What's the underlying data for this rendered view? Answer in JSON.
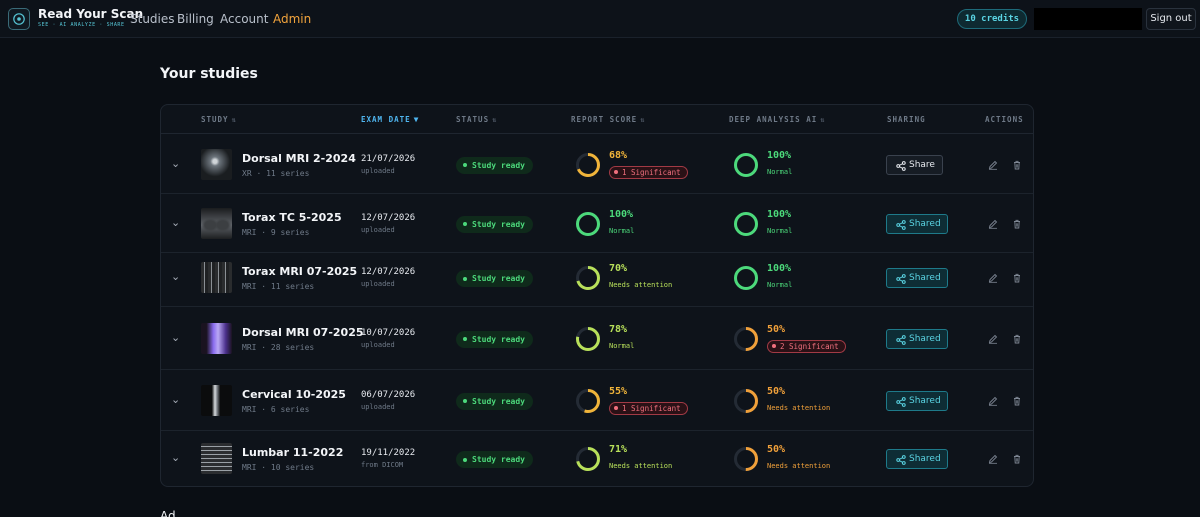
{
  "header": {
    "brand": "Read Your Scan",
    "tagline": "SEE · AI ANALYZE · SHARE",
    "nav": [
      "Studies",
      "Billing",
      "Account",
      "Admin"
    ],
    "credits": "10 credits",
    "signout_label": "Sign out"
  },
  "page": {
    "title": "Your studies"
  },
  "table": {
    "columns": [
      "STUDY",
      "EXAM DATE",
      "STATUS",
      "REPORT SCORE",
      "DEEP ANALYSIS AI",
      "SHARING",
      "ACTIONS"
    ],
    "rows": [
      {
        "name": "Dorsal MRI 2-2024",
        "sub": "XR · 11 series",
        "date": "21/07/2026",
        "date_sub": "uploaded",
        "status": "Study ready",
        "report": {
          "value": "68%",
          "pct": 68,
          "label": "1 Significant",
          "kind": "significant",
          "color": "#f0b43a"
        },
        "deep": {
          "value": "100%",
          "pct": 100,
          "label": "Normal",
          "kind": "text",
          "color": "#4cd97b"
        },
        "share": "Share",
        "shared": false
      },
      {
        "name": "Torax TC 5-2025",
        "sub": "MRI · 9 series",
        "date": "12/07/2026",
        "date_sub": "uploaded",
        "status": "Study ready",
        "report": {
          "value": "100%",
          "pct": 100,
          "label": "Normal",
          "kind": "text",
          "color": "#4cd97b"
        },
        "deep": {
          "value": "100%",
          "pct": 100,
          "label": "Normal",
          "kind": "text",
          "color": "#4cd97b"
        },
        "share": "Shared",
        "shared": true
      },
      {
        "name": "Torax MRI 07-2025",
        "sub": "MRI · 11 series",
        "date": "12/07/2026",
        "date_sub": "uploaded",
        "status": "Study ready",
        "report": {
          "value": "70%",
          "pct": 70,
          "label": "Needs attention",
          "kind": "text",
          "color": "#b8e05a"
        },
        "deep": {
          "value": "100%",
          "pct": 100,
          "label": "Normal",
          "kind": "text",
          "color": "#4cd97b"
        },
        "share": "Shared",
        "shared": true
      },
      {
        "name": "Dorsal MRI 07-2025",
        "sub": "MRI · 28 series",
        "date": "10/07/2026",
        "date_sub": "uploaded",
        "status": "Study ready",
        "report": {
          "value": "78%",
          "pct": 78,
          "label": "Normal",
          "kind": "text",
          "color": "#b8e05a"
        },
        "deep": {
          "value": "50%",
          "pct": 50,
          "label": "2 Significant",
          "kind": "significant",
          "color": "#f0a03a"
        },
        "share": "Shared",
        "shared": true
      },
      {
        "name": "Cervical 10-2025",
        "sub": "MRI · 6 series",
        "date": "06/07/2026",
        "date_sub": "uploaded",
        "status": "Study ready",
        "report": {
          "value": "55%",
          "pct": 55,
          "label": "1 Significant",
          "kind": "significant",
          "color": "#f0b43a"
        },
        "deep": {
          "value": "50%",
          "pct": 50,
          "label": "Needs attention",
          "kind": "text",
          "color": "#f0a03a"
        },
        "share": "Shared",
        "shared": true
      },
      {
        "name": "Lumbar 11-2022",
        "sub": "MRI · 10 series",
        "date": "19/11/2022",
        "date_sub": "from DICOM",
        "status": "Study ready",
        "report": {
          "value": "71%",
          "pct": 71,
          "label": "Needs attention",
          "kind": "text",
          "color": "#b8e05a"
        },
        "deep": {
          "value": "50%",
          "pct": 50,
          "label": "Needs attention",
          "kind": "text",
          "color": "#f0a03a"
        },
        "share": "Shared",
        "shared": true
      }
    ]
  },
  "below_fold_text": "Ad"
}
